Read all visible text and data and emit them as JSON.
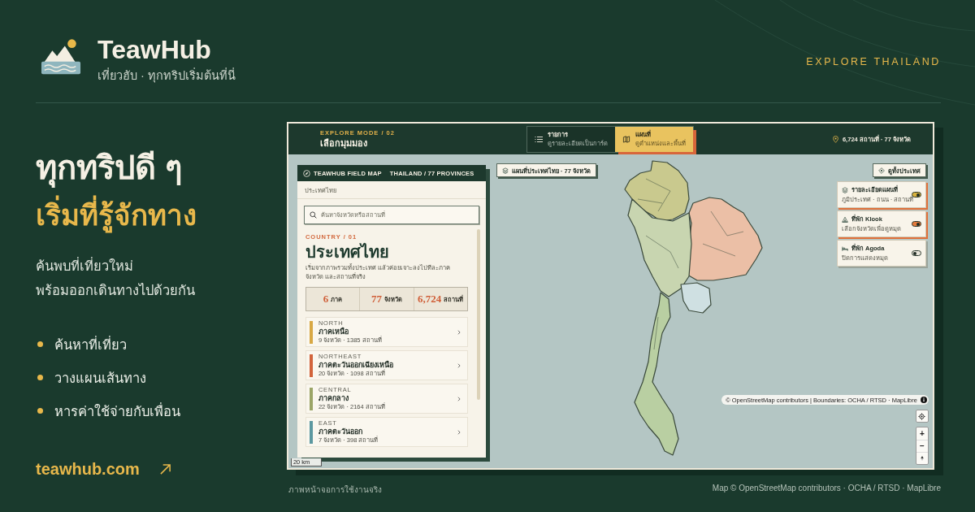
{
  "brand": {
    "name": "TeawHub",
    "tagline": "เที่ยวฮับ · ทุกทริปเริ่มต้นที่นี่"
  },
  "header_label": "EXPLORE THAILAND",
  "hero": {
    "title": "ทุกทริปดี ๆ",
    "subtitle": "เริ่มที่รู้จักทาง",
    "description": [
      "ค้นพบที่เที่ยวใหม่",
      "พร้อมออกเดินทางไปด้วยกัน"
    ]
  },
  "features": [
    "ค้นหาที่เที่ยว",
    "วางแผนเส้นทาง",
    "หารค่าใช้จ่ายกับเพื่อน"
  ],
  "link": "teawhub.com",
  "app": {
    "top_bar": {
      "eyebrow": "EXPLORE MODE / 02",
      "title": "เลือกมุมมอง",
      "views": [
        {
          "kind": "list",
          "label": "รายการ",
          "hint": "ดูรายละเอียดเป็นการ์ด",
          "selected": false
        },
        {
          "kind": "map",
          "label": "แผนที่",
          "hint": "ดูตำแหน่งและพื้นที่",
          "selected": true
        }
      ],
      "summary": "6,724 สถานที่ · 77 จังหวัด"
    },
    "panel": {
      "brand": "TEAWHUB FIELD MAP",
      "scope": "THAILAND / 77 PROVINCES",
      "breadcrumb": "ประเทศไทย",
      "search": {
        "placeholder": "ค้นหาจังหวัดหรือสถานที่"
      },
      "eyebrow": "COUNTRY / 01",
      "title": "ประเทศไทย",
      "description": "เริ่มจากภาพรวมทั้งประเทศ แล้วค่อยเจาะลงไปทีละภาค จังหวัด และสถานที่จริง",
      "stats": [
        {
          "value": "6",
          "label": "ภาค"
        },
        {
          "value": "77",
          "label": "จังหวัด"
        },
        {
          "value": "6,724",
          "label": "สถานที่"
        }
      ],
      "regions": [
        {
          "code": "NORTH",
          "name": "ภาคเหนือ",
          "meta": "9 จังหวัด · 1385 สถานที่",
          "color": "#d8a844"
        },
        {
          "code": "NORTHEAST",
          "name": "ภาคตะวันออกเฉียงเหนือ",
          "meta": "20 จังหวัด · 1098 สถานที่",
          "color": "#d2643c"
        },
        {
          "code": "CENTRAL",
          "name": "ภาคกลาง",
          "meta": "22 จังหวัด · 2164 สถานที่",
          "color": "#9ba567"
        },
        {
          "code": "EAST",
          "name": "ภาคตะวันออก",
          "meta": "7 จังหวัด · 398 สถานที่",
          "color": "#5c98a0"
        }
      ]
    },
    "map": {
      "title": "แผนที่ประเทศไทย · 77 จังหวัด",
      "reset_button": "ดูทั้งประเทศ",
      "layers": [
        {
          "kind": "map",
          "title": "รายละเอียดแผนที่",
          "hint": "ภูมิประเทศ · ถนน · สถานที่",
          "on": true,
          "color": "#d9b23f"
        },
        {
          "kind": "camp",
          "title": "ที่พัก Klook",
          "hint": "เลือกจังหวัดเพื่อดูหมุด",
          "on": true,
          "color": "#e27a3c"
        },
        {
          "kind": "hotel",
          "title": "ที่พัก Agoda",
          "hint": "ปิดการแสดงหมุด",
          "on": false
        }
      ],
      "attribution": "© OpenStreetMap contributors | Boundaries: OCHA / RTSD · MapLibre",
      "zoom_controls": [
        "+",
        "−"
      ],
      "scale": "20 km"
    }
  },
  "caption": "ภาพหน้าจอการใช้งานจริง",
  "credit": "Map © OpenStreetMap contributors · OCHA / RTSD · MapLibre"
}
